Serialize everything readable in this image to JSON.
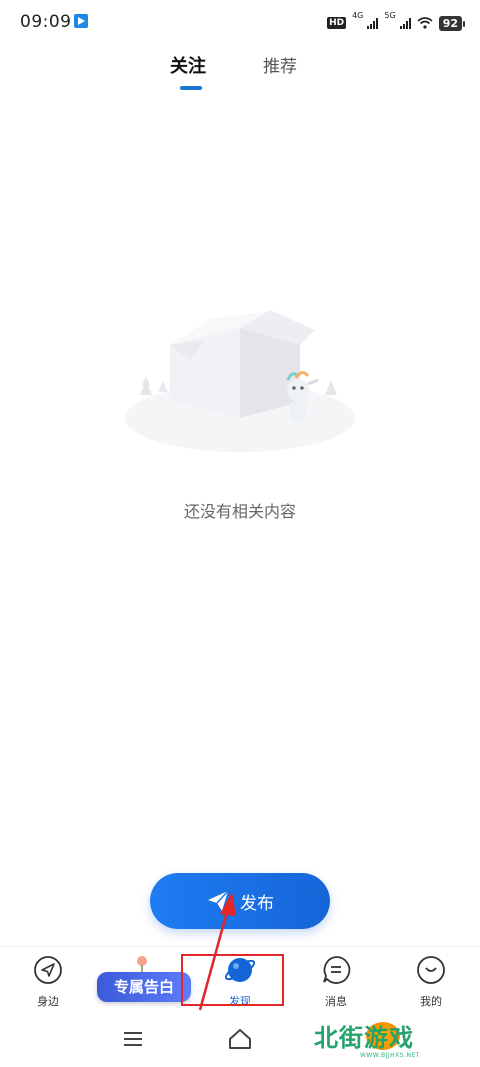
{
  "status_bar": {
    "time": "09:09",
    "hd_label": "HD",
    "sim1_label": "4G",
    "sim2_label": "5G",
    "battery": "92"
  },
  "tabs": {
    "follow": "关注",
    "recommend": "推荐",
    "active": "follow"
  },
  "empty_state": {
    "message": "还没有相关内容"
  },
  "publish_button": {
    "label": "发布"
  },
  "promo_badge": {
    "label": "专属告白"
  },
  "bottom_nav": [
    {
      "key": "nearby",
      "label": "身边",
      "icon": "compass-arrow-icon"
    },
    {
      "key": "discover",
      "label": "发现",
      "icon": "planet-icon",
      "active": true
    },
    {
      "key": "messages",
      "label": "消息",
      "icon": "chat-bubble-icon"
    },
    {
      "key": "mine",
      "label": "我的",
      "icon": "profile-face-icon"
    }
  ],
  "watermark": {
    "text": "北街游戏",
    "url": "WWW.BJJHXS.NET"
  },
  "colors": {
    "accent": "#1565d8",
    "annotation": "#e2262a",
    "watermark": "#24a36b"
  }
}
